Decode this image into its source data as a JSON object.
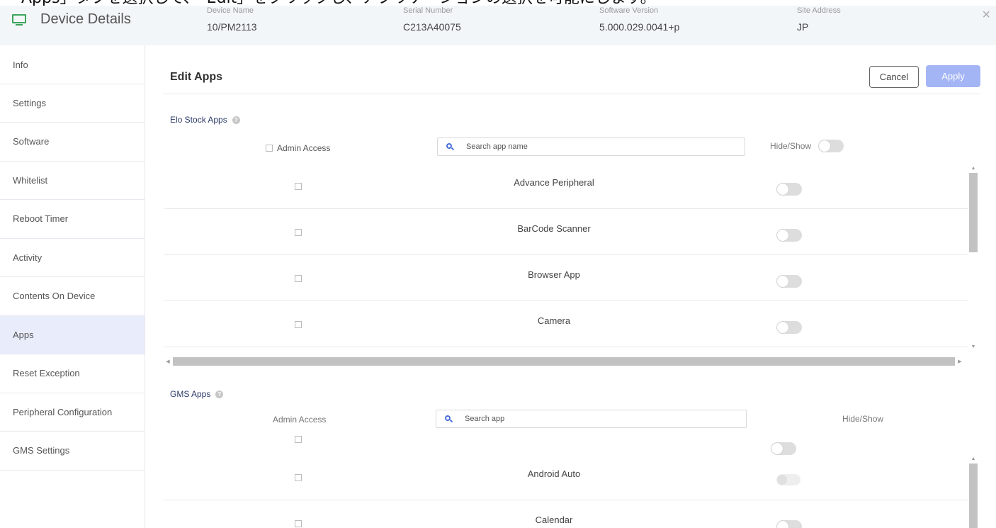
{
  "caption": "「Apps」タブを選択して、「Edit」をクリックし、アプリケーションの選択を可能にします。",
  "header": {
    "title": "Device Details",
    "fields": [
      {
        "label": "Device Name",
        "value": "10/PM2113"
      },
      {
        "label": "Serial Number",
        "value": "C213A40075"
      },
      {
        "label": "Software Version",
        "value": "5.000.029.0041+p"
      },
      {
        "label": "Site Address",
        "value": "JP"
      }
    ],
    "close": "×"
  },
  "sidebar": {
    "items": [
      {
        "label": "Info"
      },
      {
        "label": "Settings"
      },
      {
        "label": "Software"
      },
      {
        "label": "Whitelist"
      },
      {
        "label": "Reboot Timer"
      },
      {
        "label": "Activity"
      },
      {
        "label": "Contents On Device"
      },
      {
        "label": "Apps",
        "active": true
      },
      {
        "label": "Reset Exception"
      },
      {
        "label": "Peripheral Configuration"
      },
      {
        "label": "GMS Settings"
      }
    ]
  },
  "main": {
    "title": "Edit Apps",
    "cancel_label": "Cancel",
    "apply_label": "Apply",
    "stock": {
      "section_title": "Elo Stock Apps",
      "admin_access_label": "Admin Access",
      "search_placeholder": "Search app name",
      "hide_show_label": "Hide/Show",
      "apps": [
        {
          "name": "Advance Peripheral"
        },
        {
          "name": "BarCode Scanner"
        },
        {
          "name": "Browser App"
        },
        {
          "name": "Camera"
        }
      ]
    },
    "gms": {
      "section_title": "GMS Apps",
      "admin_access_label": "Admin Access",
      "search_placeholder": "Search app",
      "hide_show_label": "Hide/Show",
      "apps": [
        {
          "name": "Android Auto"
        },
        {
          "name": "Calendar"
        }
      ]
    }
  },
  "colors": {
    "accent": "#a3b5f4",
    "active_nav": "#e8ecfb",
    "header_bg": "#f3f6f9",
    "icon_green": "#3aa55b",
    "search_icon": "#4a6ee0"
  }
}
